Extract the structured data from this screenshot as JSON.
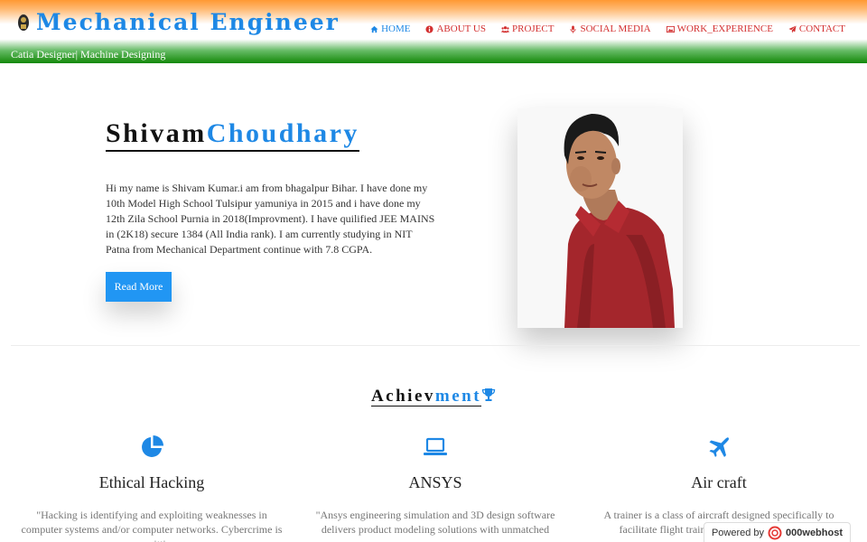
{
  "header": {
    "title": "Mechanical Engineer",
    "tagline": "Catia Designer| Machine Designing",
    "nav": [
      {
        "label": "HOME",
        "icon": "home-icon",
        "active": true
      },
      {
        "label": "ABOUT US",
        "icon": "info-icon"
      },
      {
        "label": "PROJECT",
        "icon": "users-icon"
      },
      {
        "label": "SOCIAL MEDIA",
        "icon": "microphone-icon"
      },
      {
        "label": "WORK_EXPERIENCE",
        "icon": "image-icon"
      },
      {
        "label": "CONTACT",
        "icon": "paper-plane-icon"
      }
    ]
  },
  "hero": {
    "first_name": "Shivam",
    "last_name": "Choudhary",
    "bio": "Hi my name is Shivam Kumar.i am from bhagalpur Bihar. I have done my 10th Model High School Tulsipur yamuniya in 2015 and i have done my 12th Zila School Purnia in 2018(Improvment). I have quilified JEE MAINS in (2K18) secure 1384 (All India rank). I am currently studying in NIT Patna from Mechanical Department continue with 7.8 CGPA.",
    "read_more": "Read More"
  },
  "achievements": {
    "title_part1": "Achiev",
    "title_part2": "ment",
    "cards": [
      {
        "icon": "pie-chart-icon",
        "title": "Ethical Hacking",
        "text": "\"Hacking is identifying and exploiting weaknesses in computer systems and/or computer networks. Cybercrime is committing"
      },
      {
        "icon": "laptop-icon",
        "title": "ANSYS",
        "text": "\"Ansys engineering simulation and 3D design software delivers product modeling solutions with unmatched"
      },
      {
        "icon": "plane-icon",
        "title": "Air craft",
        "text": "A trainer is a class of aircraft designed specifically to facilitate flight training of pilots and aircrews."
      }
    ]
  },
  "footer": {
    "powered_by": "Powered by",
    "host": "000webhost"
  },
  "colors": {
    "accent": "#1e88e5",
    "nav_text": "#d32f2f",
    "saffron": "#ff9933",
    "green": "#138808"
  }
}
